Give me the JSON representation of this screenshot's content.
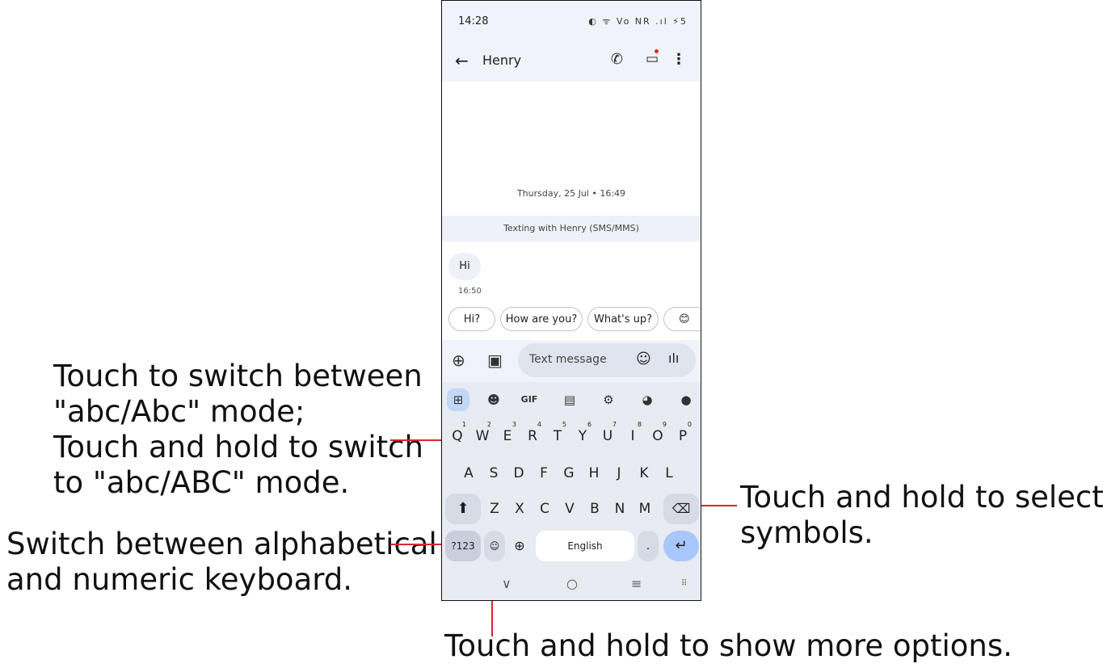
{
  "phone": {
    "status": {
      "time": "14:28",
      "icons": "◐ ᯤ Vo NR .ıl ⚡5"
    },
    "header": {
      "title": "Henry"
    },
    "conversation": {
      "date": "Thursday, 25 Jul • 16:49",
      "texting_with": "Texting with Henry (SMS/MMS)",
      "message": "Hi",
      "message_time": "16:50"
    },
    "smart_replies": [
      "Hi?",
      "How are you?",
      "What's up?",
      "😊"
    ],
    "composer": {
      "placeholder": "Text message"
    },
    "keyboard": {
      "gif_label": "GIF",
      "row1": [
        "Q",
        "W",
        "E",
        "R",
        "T",
        "Y",
        "U",
        "I",
        "O",
        "P"
      ],
      "row1_digits": [
        "1",
        "2",
        "3",
        "4",
        "5",
        "6",
        "7",
        "8",
        "9",
        "0"
      ],
      "row2": [
        "A",
        "S",
        "D",
        "F",
        "G",
        "H",
        "J",
        "K",
        "L"
      ],
      "row3": [
        "Z",
        "X",
        "C",
        "V",
        "B",
        "N",
        "M"
      ],
      "symbols_key": "?123",
      "space_label": "English",
      "period": "."
    }
  },
  "callouts": {
    "shift": [
      "Touch to switch between",
      "\"abc/Abc\" mode;",
      "Touch and hold to switch",
      "to \"abc/ABC\" mode."
    ],
    "numeric": [
      "Switch between alphabetical",
      "and numeric keyboard."
    ],
    "symbols": [
      "Touch and hold to select",
      "symbols."
    ],
    "emoji": "Touch and hold to show more options."
  },
  "colors": {
    "callout_line": "#d9262e",
    "accent": "#c2d8f5"
  }
}
